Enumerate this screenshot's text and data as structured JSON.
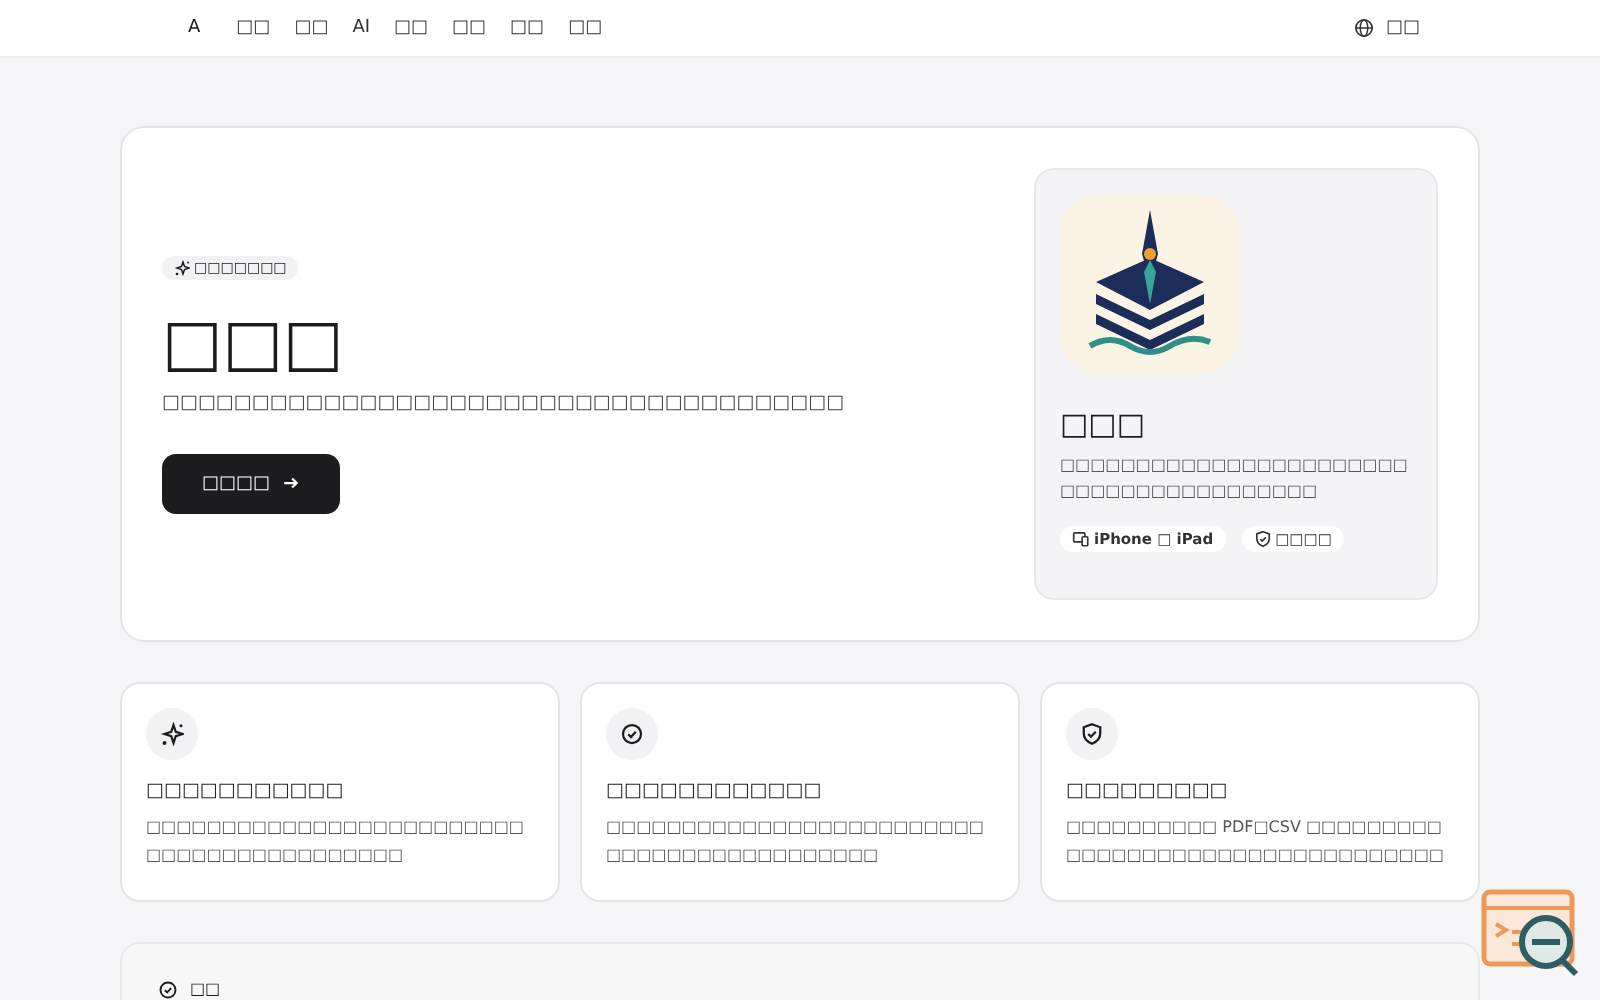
{
  "nav": {
    "logo": "A",
    "items": [
      "□□",
      "□□",
      "AI",
      "□□",
      "□□",
      "□□",
      "□□"
    ],
    "language": "□□"
  },
  "hero": {
    "badge": "□□□□□□□",
    "title": "□□□",
    "subtitle": "□□□□□□□□□□□□□□□□□□□□□□□□□□□□□□□□□□□□□□",
    "button": "□□□□",
    "app": {
      "name": "□□□",
      "description": "□□□□□□□□□□□□□□□□□□□□□□□□□□□□□□□□□□□□□□□□",
      "tags": [
        {
          "kind": "device",
          "label": "iPhone □ iPad"
        },
        {
          "kind": "shield",
          "label": "□□□□"
        }
      ]
    }
  },
  "features": [
    {
      "kind": "sparkle",
      "title": "□□□□□□□□□□□",
      "description": "□□□□□□□□□□□□□□□□□□□□□□□□□□□□□□□□□□□□□□□□□□"
    },
    {
      "kind": "check",
      "title": "□□□□□□□□□□□□",
      "description": "□□□□□□□□□□□□□□□□□□□□□□□□□□□□□□□□□□□□□□□□□□□"
    },
    {
      "kind": "shield",
      "title": "□□□□□□□□□",
      "description": "□□□□□□□□□□ PDF□CSV □□□□□□□□□□□□□□□□□□□□□□□□□□□□□□□□□□"
    }
  ],
  "bottom": {
    "title": "□□"
  }
}
